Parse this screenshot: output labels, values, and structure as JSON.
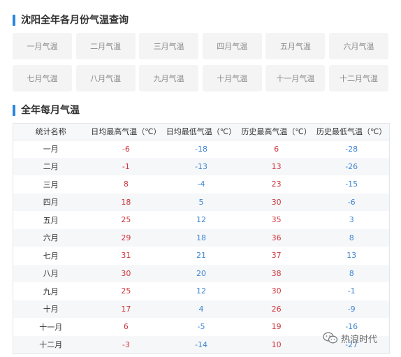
{
  "query_section": {
    "title": "沈阳全年各月份气温查询",
    "months": [
      "一月气温",
      "二月气温",
      "三月气温",
      "四月气温",
      "五月气温",
      "六月气温",
      "七月气温",
      "八月气温",
      "九月气温",
      "十月气温",
      "十一月气温",
      "十二月气温"
    ]
  },
  "annual_section": {
    "title": "全年每月气温",
    "columns": [
      "统计名称",
      "日均最高气温（℃）",
      "日均最低气温（℃）",
      "历史最高气温（℃）",
      "历史最低气温（℃）"
    ],
    "rows": [
      {
        "month": "一月",
        "avg_high": "-6",
        "avg_low": "-18",
        "record_high": "6",
        "record_low": "-28"
      },
      {
        "month": "二月",
        "avg_high": "-1",
        "avg_low": "-13",
        "record_high": "13",
        "record_low": "-26"
      },
      {
        "month": "三月",
        "avg_high": "8",
        "avg_low": "-4",
        "record_high": "23",
        "record_low": "-15"
      },
      {
        "month": "四月",
        "avg_high": "18",
        "avg_low": "5",
        "record_high": "30",
        "record_low": "-6"
      },
      {
        "month": "五月",
        "avg_high": "25",
        "avg_low": "12",
        "record_high": "35",
        "record_low": "3"
      },
      {
        "month": "六月",
        "avg_high": "29",
        "avg_low": "18",
        "record_high": "36",
        "record_low": "8"
      },
      {
        "month": "七月",
        "avg_high": "31",
        "avg_low": "21",
        "record_high": "37",
        "record_low": "13"
      },
      {
        "month": "八月",
        "avg_high": "30",
        "avg_low": "20",
        "record_high": "38",
        "record_low": "8"
      },
      {
        "month": "九月",
        "avg_high": "25",
        "avg_low": "12",
        "record_high": "30",
        "record_low": "-1"
      },
      {
        "month": "十月",
        "avg_high": "17",
        "avg_low": "4",
        "record_high": "26",
        "record_low": "-9"
      },
      {
        "month": "十一月",
        "avg_high": "6",
        "avg_low": "-5",
        "record_high": "19",
        "record_low": "-16"
      },
      {
        "month": "十二月",
        "avg_high": "-3",
        "avg_low": "-14",
        "record_high": "10",
        "record_low": "-27"
      }
    ]
  },
  "watermark": {
    "text": "热浪时代",
    "icon": "wechat-icon"
  },
  "colors": {
    "accent_bar": "#2b86e0",
    "high_temp": "#d0363d",
    "low_temp": "#3f86d3"
  }
}
